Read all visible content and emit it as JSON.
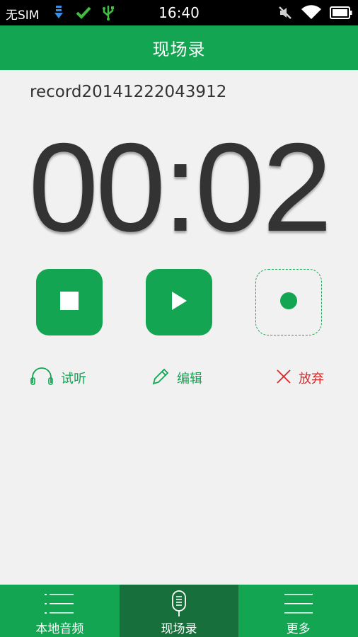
{
  "status_bar": {
    "carrier": "无SIM",
    "time": "16:40"
  },
  "header": {
    "title": "现场录"
  },
  "recording": {
    "file_name": "record20141222043912",
    "elapsed": "00:02"
  },
  "actions": {
    "listen_label": "试听",
    "edit_label": "编辑",
    "discard_label": "放弃"
  },
  "bottom_nav": {
    "items": [
      {
        "label": "本地音频"
      },
      {
        "label": "现场录"
      },
      {
        "label": "更多"
      }
    ]
  },
  "colors": {
    "accent": "#13a552",
    "accent_dark": "#17703c",
    "discard": "#d9282a",
    "text": "#333333",
    "background": "#f1f1f1"
  }
}
